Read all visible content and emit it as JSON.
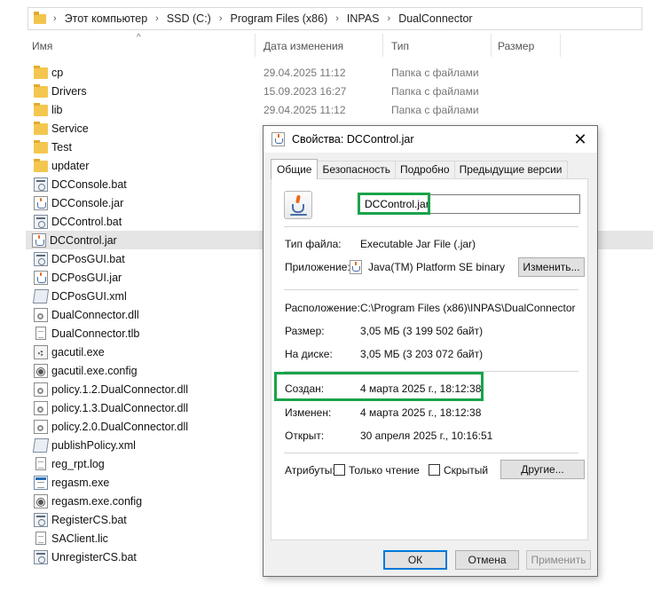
{
  "address_bar": {
    "crumbs": [
      "Этот компьютер",
      "SSD (C:)",
      "Program Files (x86)",
      "INPAS",
      "DualConnector"
    ]
  },
  "columns": {
    "name": "Имя",
    "date": "Дата изменения",
    "type": "Тип",
    "size": "Размер"
  },
  "files": [
    {
      "name": "cp",
      "date": "29.04.2025 11:12",
      "type": "Папка с файлами",
      "icon": "folder-icon"
    },
    {
      "name": "Drivers",
      "date": "15.09.2023 16:27",
      "type": "Папка с файлами",
      "icon": "folder-icon"
    },
    {
      "name": "lib",
      "date": "29.04.2025 11:12",
      "type": "Папка с файлами",
      "icon": "folder-icon"
    },
    {
      "name": "Service",
      "date": "",
      "type": "",
      "icon": "folder-icon"
    },
    {
      "name": "Test",
      "date": "",
      "type": "",
      "icon": "folder-icon"
    },
    {
      "name": "updater",
      "date": "",
      "type": "",
      "icon": "folder-icon"
    },
    {
      "name": "DCConsole.bat",
      "date": "",
      "type": "",
      "icon": "bat-file-icon"
    },
    {
      "name": "DCConsole.jar",
      "date": "",
      "type": "",
      "icon": "jar-file-icon"
    },
    {
      "name": "DCControl.bat",
      "date": "",
      "type": "",
      "icon": "bat-file-icon"
    },
    {
      "name": "DCControl.jar",
      "date": "",
      "type": "",
      "icon": "jar-file-icon",
      "selected": true
    },
    {
      "name": "DCPosGUI.bat",
      "date": "",
      "type": "",
      "icon": "bat-file-icon"
    },
    {
      "name": "DCPosGUI.jar",
      "date": "",
      "type": "",
      "icon": "jar-file-icon"
    },
    {
      "name": "DCPosGUI.xml",
      "date": "",
      "type": "",
      "icon": "xml-file-icon"
    },
    {
      "name": "DualConnector.dll",
      "date": "",
      "type": "",
      "icon": "dll-file-icon"
    },
    {
      "name": "DualConnector.tlb",
      "date": "",
      "type": "",
      "icon": "blank-file-icon"
    },
    {
      "name": "gacutil.exe",
      "date": "",
      "type": "",
      "icon": "exe-file-icon"
    },
    {
      "name": "gacutil.exe.config",
      "date": "",
      "type": "",
      "icon": "config-file-icon"
    },
    {
      "name": "policy.1.2.DualConnector.dll",
      "date": "",
      "type": "",
      "icon": "dll-file-icon"
    },
    {
      "name": "policy.1.3.DualConnector.dll",
      "date": "",
      "type": "",
      "icon": "dll-file-icon"
    },
    {
      "name": "policy.2.0.DualConnector.dll",
      "date": "",
      "type": "",
      "icon": "dll-file-icon"
    },
    {
      "name": "publishPolicy.xml",
      "date": "",
      "type": "",
      "icon": "xml-file-icon"
    },
    {
      "name": "reg_rpt.log",
      "date": "",
      "type": "",
      "icon": "text-file-icon"
    },
    {
      "name": "regasm.exe",
      "date": "",
      "type": "",
      "icon": "regasm-exe-icon"
    },
    {
      "name": "regasm.exe.config",
      "date": "",
      "type": "",
      "icon": "config-file-icon"
    },
    {
      "name": "RegisterCS.bat",
      "date": "",
      "type": "",
      "icon": "bat-file-icon"
    },
    {
      "name": "SAClient.lic",
      "date": "",
      "type": "",
      "icon": "blank-file-icon"
    },
    {
      "name": "UnregisterCS.bat",
      "date": "",
      "type": "",
      "icon": "bat-file-icon"
    }
  ],
  "dialog": {
    "title": "Свойства: DCControl.jar",
    "close_glyph": "✕",
    "tabs": [
      "Общие",
      "Безопасность",
      "Подробно",
      "Предыдущие версии"
    ],
    "active_tab": "Общие",
    "file_name": "DCControl.jar",
    "file_type_label": "Тип файла:",
    "file_type_value": "Executable Jar File (.jar)",
    "app_label": "Приложение:",
    "app_value": "Java(TM) Platform SE binary",
    "change_button": "Изменить...",
    "location_label": "Расположение:",
    "location_value": "C:\\Program Files (x86)\\INPAS\\DualConnector",
    "size_label": "Размер:",
    "size_value": "3,05 МБ (3 199 502 байт)",
    "disk_label": "На диске:",
    "disk_value": "3,05 МБ (3 203 072 байт)",
    "created_label": "Создан:",
    "created_value": "4 марта 2025 г., 18:12:38",
    "modified_label": "Изменен:",
    "modified_value": "4 марта 2025 г., 18:12:38",
    "opened_label": "Открыт:",
    "opened_value": "30 апреля 2025 г., 10:16:51",
    "attributes_label": "Атрибуты:",
    "readonly_label": "Только чтение",
    "hidden_label": "Скрытый",
    "other_button": "Другие...",
    "ok_button": "ОК",
    "cancel_button": "Отмена",
    "apply_button": "Применить"
  },
  "colors": {
    "highlight": "#1aa34a",
    "ok_border": "#0078d7",
    "selection": "#e5e5e5"
  }
}
